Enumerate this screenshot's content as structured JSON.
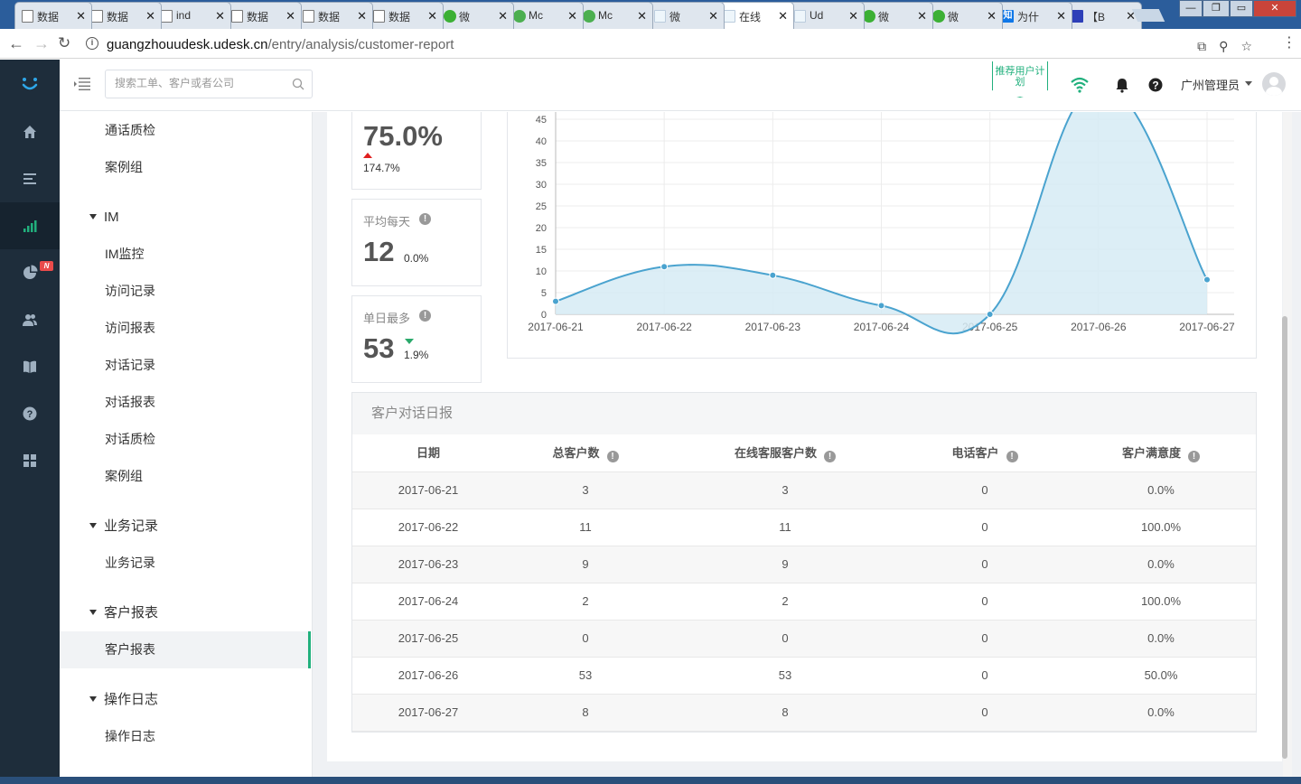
{
  "browser": {
    "tabs": [
      {
        "label": "数据",
        "icon": "page"
      },
      {
        "label": "数据",
        "icon": "page"
      },
      {
        "label": "ind",
        "icon": "page"
      },
      {
        "label": "数据",
        "icon": "page"
      },
      {
        "label": "数据",
        "icon": "page"
      },
      {
        "label": "数据",
        "icon": "page"
      },
      {
        "label": "微",
        "icon": "wechat"
      },
      {
        "label": "Mc",
        "icon": "mc"
      },
      {
        "label": "Mc",
        "icon": "mc"
      },
      {
        "label": "微",
        "icon": "udesk"
      },
      {
        "label": "在线",
        "icon": "udesk",
        "active": true
      },
      {
        "label": "Ud",
        "icon": "udesk"
      },
      {
        "label": "微",
        "icon": "wechat"
      },
      {
        "label": "微",
        "icon": "wechat"
      },
      {
        "label": "为什",
        "icon": "zhi"
      },
      {
        "label": "【B",
        "icon": "paw"
      }
    ],
    "url_host": "guangzhouudesk.udesk.cn",
    "url_path": "/entry/analysis/customer-report"
  },
  "topbar": {
    "search_placeholder": "搜索工单、客户或者公司",
    "recommend_label": "推荐用户计划",
    "user_name": "广州管理员"
  },
  "rail": {
    "badge": "N"
  },
  "sidebar": {
    "items": [
      {
        "label": "通话质检",
        "type": "item"
      },
      {
        "label": "案例组",
        "type": "item"
      },
      {
        "label": "IM",
        "type": "group"
      },
      {
        "label": "IM监控",
        "type": "item"
      },
      {
        "label": "访问记录",
        "type": "item"
      },
      {
        "label": "访问报表",
        "type": "item"
      },
      {
        "label": "对话记录",
        "type": "item"
      },
      {
        "label": "对话报表",
        "type": "item"
      },
      {
        "label": "对话质检",
        "type": "item"
      },
      {
        "label": "案例组",
        "type": "item"
      },
      {
        "label": "业务记录",
        "type": "group"
      },
      {
        "label": "业务记录",
        "type": "item"
      },
      {
        "label": "客户报表",
        "type": "group"
      },
      {
        "label": "客户报表",
        "type": "item",
        "active": true
      },
      {
        "label": "操作日志",
        "type": "group"
      },
      {
        "label": "操作日志",
        "type": "item"
      }
    ]
  },
  "stats": {
    "first": {
      "value": "75.0%",
      "delta": "174.7%",
      "trend": "up"
    },
    "avg": {
      "label": "平均每天",
      "value": "12",
      "delta": "0.0%"
    },
    "max": {
      "label": "单日最多",
      "value": "53",
      "delta": "1.9%",
      "trend": "down"
    }
  },
  "chart_data": {
    "type": "area",
    "x": [
      "2017-06-21",
      "2017-06-22",
      "2017-06-23",
      "2017-06-24",
      "2017-06-25",
      "2017-06-26",
      "2017-06-27"
    ],
    "series": [
      {
        "values": [
          3,
          11,
          9,
          2,
          0,
          53,
          8
        ]
      }
    ],
    "y_ticks": [
      "0",
      "5",
      "10",
      "15",
      "20",
      "25",
      "30",
      "35",
      "40",
      "45"
    ],
    "ylim": [
      0,
      45
    ],
    "grid": true,
    "line_color": "#4aa3cf",
    "fill_color": "#d6ebf5"
  },
  "report": {
    "title": "客户对话日报",
    "columns": [
      "日期",
      "总客户数",
      "在线客服客户数",
      "电话客户",
      "客户满意度"
    ],
    "rows": [
      [
        "2017-06-21",
        "3",
        "3",
        "0",
        "0.0%"
      ],
      [
        "2017-06-22",
        "11",
        "11",
        "0",
        "100.0%"
      ],
      [
        "2017-06-23",
        "9",
        "9",
        "0",
        "0.0%"
      ],
      [
        "2017-06-24",
        "2",
        "2",
        "0",
        "100.0%"
      ],
      [
        "2017-06-25",
        "0",
        "0",
        "0",
        "0.0%"
      ],
      [
        "2017-06-26",
        "53",
        "53",
        "0",
        "50.0%"
      ],
      [
        "2017-06-27",
        "8",
        "8",
        "0",
        "0.0%"
      ]
    ]
  }
}
